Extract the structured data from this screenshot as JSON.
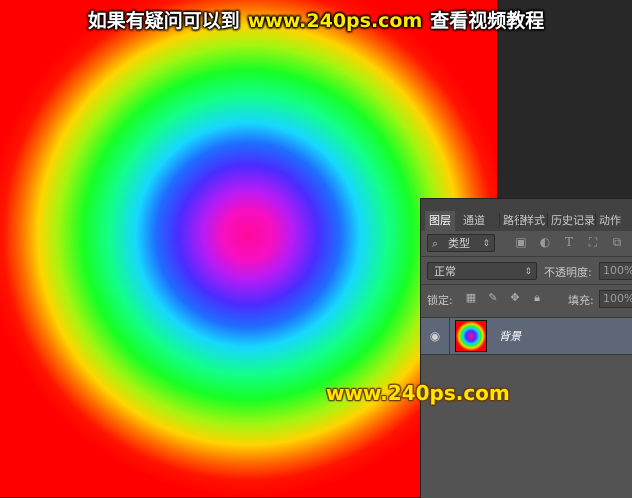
{
  "watermark": {
    "top_left": "如果有疑问可以到",
    "top_url": "www.240ps.com",
    "top_right": "查看视频教程",
    "middle": "www.240ps.com"
  },
  "panel": {
    "tabs": [
      "图层",
      "通道",
      "路径",
      "样式",
      "历史记录",
      "动作"
    ],
    "active_tab": "图层",
    "filter_type": "类型",
    "blend_mode": "正常",
    "opacity_label": "不透明度:",
    "opacity_value": "100%",
    "lock_label": "锁定:",
    "fill_label": "填充:",
    "fill_value": "100%",
    "layer": {
      "name": "背景"
    }
  },
  "icons": [
    "search-icon",
    "image-filter-icon",
    "adjust-filter-icon",
    "text-filter-icon",
    "shape-filter-icon",
    "smart-object-filter-icon",
    "lock-pixels-icon",
    "lock-brush-icon",
    "lock-position-icon",
    "lock-all-icon",
    "eye-icon"
  ],
  "colors": {
    "panel_bg": "#535353",
    "selected_layer": "#5e6778",
    "watermark_url": "#ffea00"
  }
}
